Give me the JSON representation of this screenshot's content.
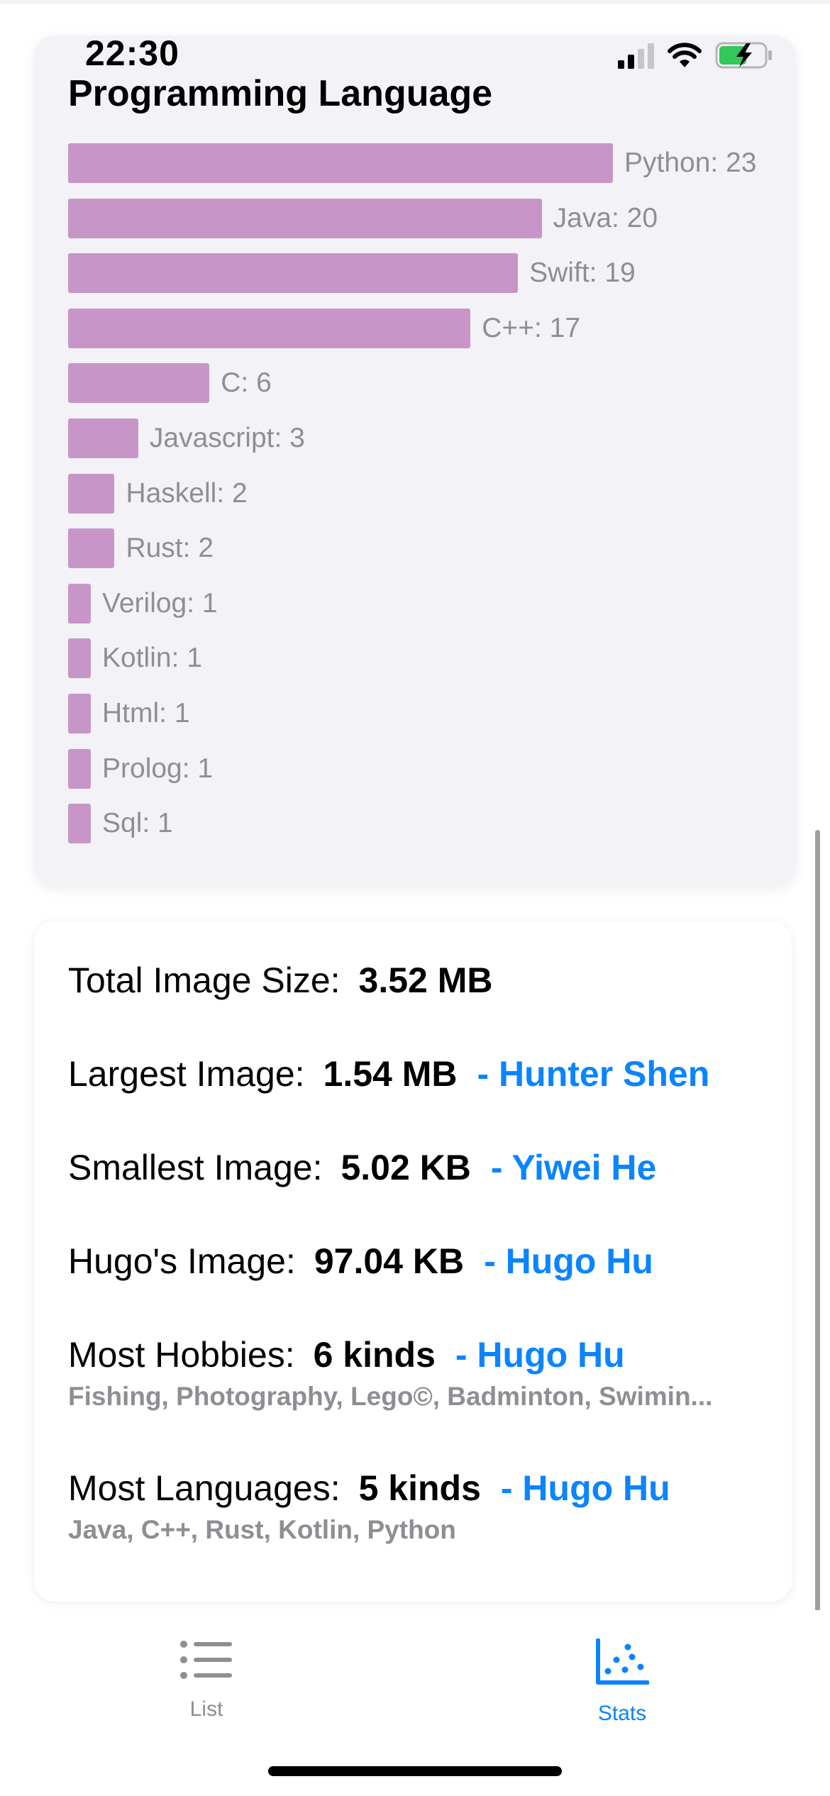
{
  "status_bar": {
    "time": "22:30"
  },
  "chart_data": {
    "type": "bar",
    "orientation": "horizontal",
    "title": "Programming Language",
    "categories": [
      "Python",
      "Java",
      "Swift",
      "C++",
      "C",
      "Javascript",
      "Haskell",
      "Rust",
      "Verilog",
      "Kotlin",
      "Html",
      "Prolog",
      "Sql"
    ],
    "values": [
      23,
      20,
      19,
      17,
      6,
      3,
      2,
      2,
      1,
      1,
      1,
      1,
      1
    ],
    "labels": [
      "Python: 23",
      "Java: 20",
      "Swift: 19",
      "C++: 17",
      "C: 6",
      "Javascript: 3",
      "Haskell: 2",
      "Rust: 2",
      "Verilog: 1",
      "Kotlin: 1",
      "Html: 1",
      "Prolog: 1",
      "Sql: 1"
    ],
    "bar_color": "#c895c8",
    "label_color": "#8e8e93",
    "xlim": [
      0,
      23
    ]
  },
  "stats": [
    {
      "label": "Total Image Size:",
      "value": "3.52 MB",
      "person": "",
      "detail": ""
    },
    {
      "label": "Largest Image:",
      "value": "1.54 MB",
      "person": "- Hunter Shen",
      "detail": ""
    },
    {
      "label": "Smallest Image:",
      "value": "5.02 KB",
      "person": "- Yiwei He",
      "detail": ""
    },
    {
      "label": "Hugo's Image:",
      "value": "97.04 KB",
      "person": "- Hugo Hu",
      "detail": ""
    },
    {
      "label": "Most Hobbies:",
      "value": "6 kinds",
      "person": "- Hugo Hu",
      "detail": "Fishing, Photography, Lego©, Badminton, Swimin..."
    },
    {
      "label": "Most Languages:",
      "value": "5 kinds",
      "person": "- Hugo Hu",
      "detail": "Java, C++, Rust, Kotlin, Python"
    }
  ],
  "tab_bar": {
    "tabs": [
      {
        "label": "List",
        "icon": "list-icon",
        "selected": false
      },
      {
        "label": "Stats",
        "icon": "stats-chart-icon",
        "selected": true
      }
    ]
  },
  "colors": {
    "accent": "#0a84ff",
    "inactive": "#8e8e93",
    "chart_card_bg": "#f2f2f7"
  }
}
